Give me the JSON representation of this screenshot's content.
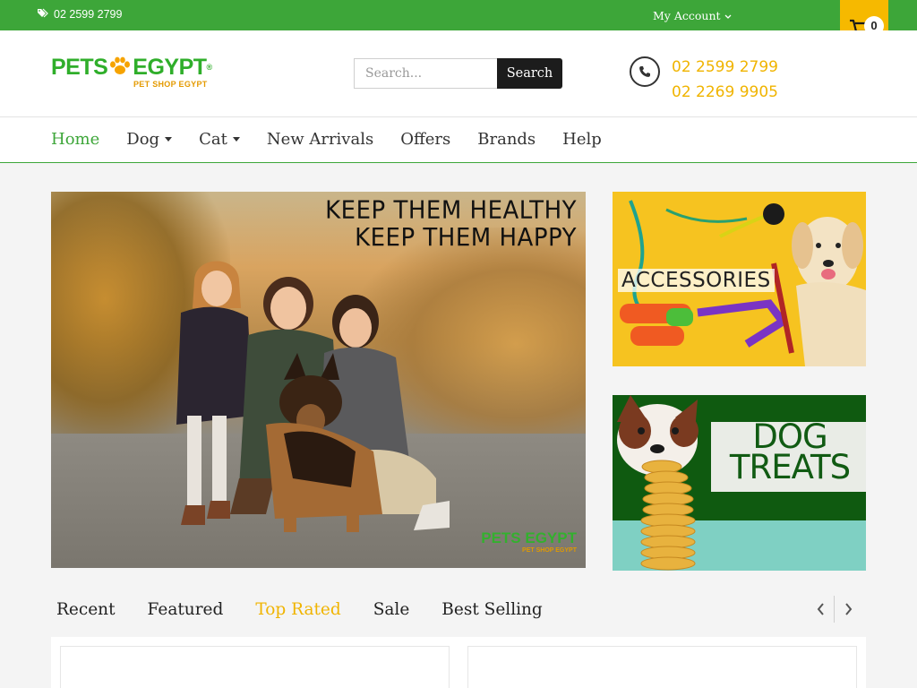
{
  "topbar": {
    "phone": "02 2599 2799",
    "phone_icon": "tags-icon",
    "account_label": "My Account",
    "cart_count": "0",
    "colors": {
      "bar": "#3da639",
      "cart": "#f6b900"
    }
  },
  "header": {
    "logo_text_left": "PETS",
    "logo_text_right": "EGYPT",
    "logo_tagline": "PET SHOP EGYPT",
    "logo_reg": "®",
    "search_placeholder": "Search...",
    "search_button": "Search",
    "phones": [
      "02 2599 2799",
      "02 2269 9905"
    ]
  },
  "nav": {
    "items": [
      {
        "label": "Home",
        "active": true,
        "dropdown": false
      },
      {
        "label": "Dog",
        "active": false,
        "dropdown": true
      },
      {
        "label": "Cat",
        "active": false,
        "dropdown": true
      },
      {
        "label": "New Arrivals",
        "active": false,
        "dropdown": false
      },
      {
        "label": "Offers",
        "active": false,
        "dropdown": false
      },
      {
        "label": "Brands",
        "active": false,
        "dropdown": false
      },
      {
        "label": "Help",
        "active": false,
        "dropdown": false
      }
    ]
  },
  "hero": {
    "line1": "KEEP THEM HEALTHY",
    "line2": "KEEP THEM HAPPY",
    "watermark": "PETS EGYPT",
    "watermark_sub": "PET SHOP EGYPT"
  },
  "banners": {
    "accessories": "ACCESSORIES",
    "treats_line1": "DOG",
    "treats_line2": "TREATS"
  },
  "tabs": {
    "items": [
      {
        "label": "Recent",
        "active": false
      },
      {
        "label": "Featured",
        "active": false
      },
      {
        "label": "Top Rated",
        "active": true
      },
      {
        "label": "Sale",
        "active": false
      },
      {
        "label": "Best Selling",
        "active": false
      }
    ]
  },
  "colors": {
    "accent_green": "#3da639",
    "accent_yellow": "#f0b400"
  }
}
